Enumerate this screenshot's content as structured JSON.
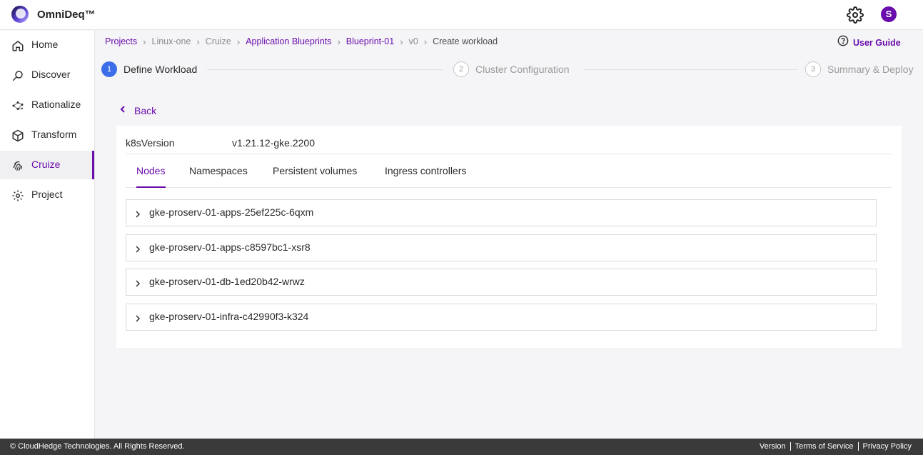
{
  "app": {
    "brand": "OmniDeq™",
    "avatar_initial": "S",
    "accent": "#6a0dad",
    "step_active_color": "#3b6ee8"
  },
  "header": {
    "settings_icon": "gear-icon"
  },
  "sidebar": {
    "items": [
      {
        "label": "Home",
        "icon": "home-icon"
      },
      {
        "label": "Discover",
        "icon": "discover-icon"
      },
      {
        "label": "Rationalize",
        "icon": "rationalize-icon"
      },
      {
        "label": "Transform",
        "icon": "cube-icon"
      },
      {
        "label": "Cruize",
        "icon": "fingerprint-icon",
        "active": true
      },
      {
        "label": "Project",
        "icon": "gear-icon"
      }
    ]
  },
  "breadcrumb": {
    "items": [
      {
        "label": "Projects",
        "style": "link"
      },
      {
        "label": "Linux-one",
        "style": "muted"
      },
      {
        "label": "Cruize",
        "style": "muted"
      },
      {
        "label": "Application Blueprints",
        "style": "link"
      },
      {
        "label": "Blueprint-01",
        "style": "link"
      },
      {
        "label": "v0",
        "style": "muted"
      },
      {
        "label": "Create workload",
        "style": "current"
      }
    ]
  },
  "user_guide": {
    "label": "User Guide",
    "icon": "help-circle-icon"
  },
  "stepper": {
    "steps": [
      {
        "num": "1",
        "label": "Define Workload",
        "active": true
      },
      {
        "num": "2",
        "label": "Cluster Configuration",
        "active": false
      },
      {
        "num": "3",
        "label": "Summary & Deploy",
        "active": false
      }
    ]
  },
  "back": {
    "label": "Back"
  },
  "workload": {
    "k8s_label": "k8sVersion",
    "k8s_value": "v1.21.12-gke.2200",
    "tabs": [
      {
        "label": "Nodes",
        "active": true
      },
      {
        "label": "Namespaces",
        "active": false
      },
      {
        "label": "Persistent volumes",
        "active": false
      },
      {
        "label": "Ingress controllers",
        "active": false
      }
    ],
    "nodes": [
      "gke-proserv-01-apps-25ef225c-6qxm",
      "gke-proserv-01-apps-c8597bc1-xsr8",
      "gke-proserv-01-db-1ed20b42-wrwz",
      "gke-proserv-01-infra-c42990f3-k324"
    ]
  },
  "footer": {
    "copyright": "© CloudHedge Technologies. All Rights Reserved.",
    "links": [
      "Version",
      "Terms of Service",
      "Privacy Policy"
    ]
  }
}
